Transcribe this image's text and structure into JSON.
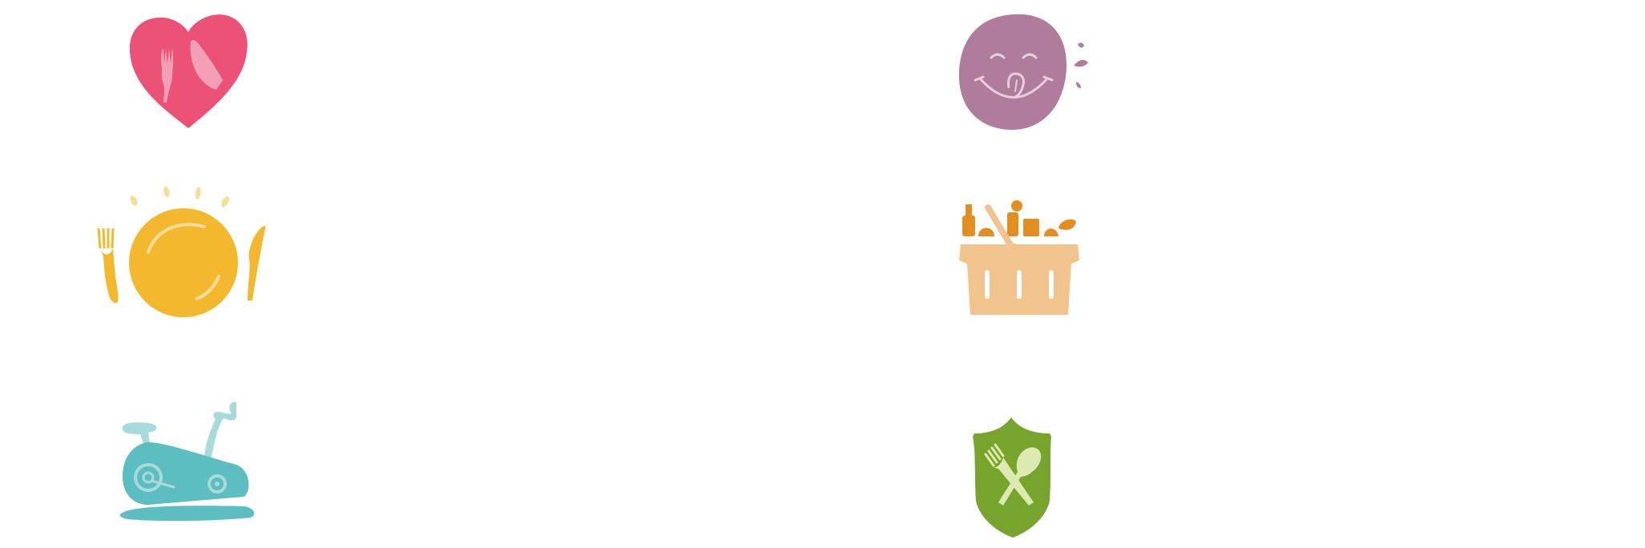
{
  "icons": [
    {
      "name": "heart-cutlery-icon",
      "color": "#EB5276",
      "accent": "#F3A0B6"
    },
    {
      "name": "tasty-face-icon",
      "color": "#B07C9B",
      "accent": "#E6CEDD"
    },
    {
      "name": "plate-cutlery-icon",
      "color": "#F3B82D",
      "accent": "#F8DD9A"
    },
    {
      "name": "grocery-basket-icon",
      "color": "#F1C48D",
      "accent": "#E38E1E"
    },
    {
      "name": "exercise-bike-icon",
      "color": "#5CBEC0",
      "accent": "#A9DADB"
    },
    {
      "name": "food-safety-shield-icon",
      "color": "#77A42D",
      "accent": "#DCE9B1"
    }
  ]
}
